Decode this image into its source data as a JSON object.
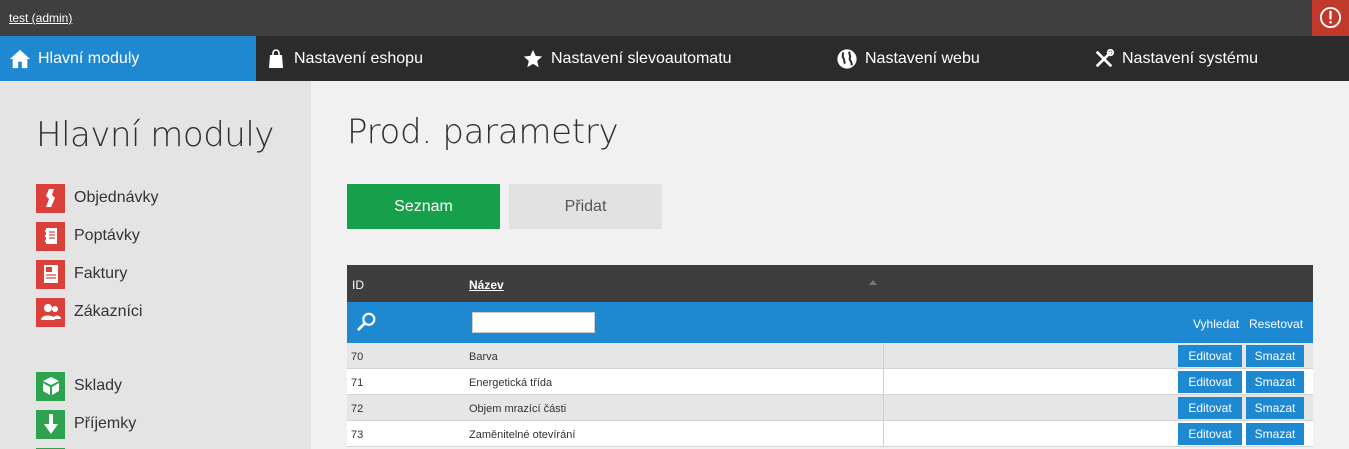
{
  "topbar": {
    "user": "test (admin)",
    "power_icon": "power-icon"
  },
  "nav": [
    {
      "label": "Hlavní moduly",
      "icon": "home-icon"
    },
    {
      "label": "Nastavení eshopu",
      "icon": "shopping-bag-icon"
    },
    {
      "label": "Nastavení slevoautomatu",
      "icon": "star-icon"
    },
    {
      "label": "Nastavení webu",
      "icon": "globe-icon"
    },
    {
      "label": "Nastavení systému",
      "icon": "tools-icon"
    }
  ],
  "sidebar": {
    "title": "Hlavní moduly",
    "items": [
      {
        "label": "Objednávky",
        "icon": "orders-icon",
        "color": "#d9413a"
      },
      {
        "label": "Poptávky",
        "icon": "notebook-icon",
        "color": "#d9413a"
      },
      {
        "label": "Faktury",
        "icon": "invoice-icon",
        "color": "#d9413a"
      },
      {
        "label": "Zákazníci",
        "icon": "users-icon",
        "color": "#d9413a"
      },
      {
        "label": "Sklady",
        "icon": "warehouse-icon",
        "color": "#2ea34f"
      },
      {
        "label": "Příjemky",
        "icon": "arrow-down-icon",
        "color": "#2ea34f"
      }
    ]
  },
  "main": {
    "title": "Prod. parametry",
    "tabs": {
      "list": "Seznam",
      "add": "Přidat"
    }
  },
  "table": {
    "columns": {
      "id": "ID",
      "name": "Název"
    },
    "filter": {
      "placeholder": "",
      "search": "Vyhledat",
      "reset": "Resetovat"
    },
    "rows": [
      {
        "id": "70",
        "name": "Barva"
      },
      {
        "id": "71",
        "name": "Energetická třída"
      },
      {
        "id": "72",
        "name": "Objem mrazící části"
      },
      {
        "id": "73",
        "name": "Zaměnitelné otevírání"
      }
    ],
    "actions": {
      "edit": "Editovat",
      "delete": "Smazat"
    }
  },
  "colors": {
    "accent": "#1e88d1",
    "primary_button": "#17a04b",
    "danger": "#c0392b"
  }
}
